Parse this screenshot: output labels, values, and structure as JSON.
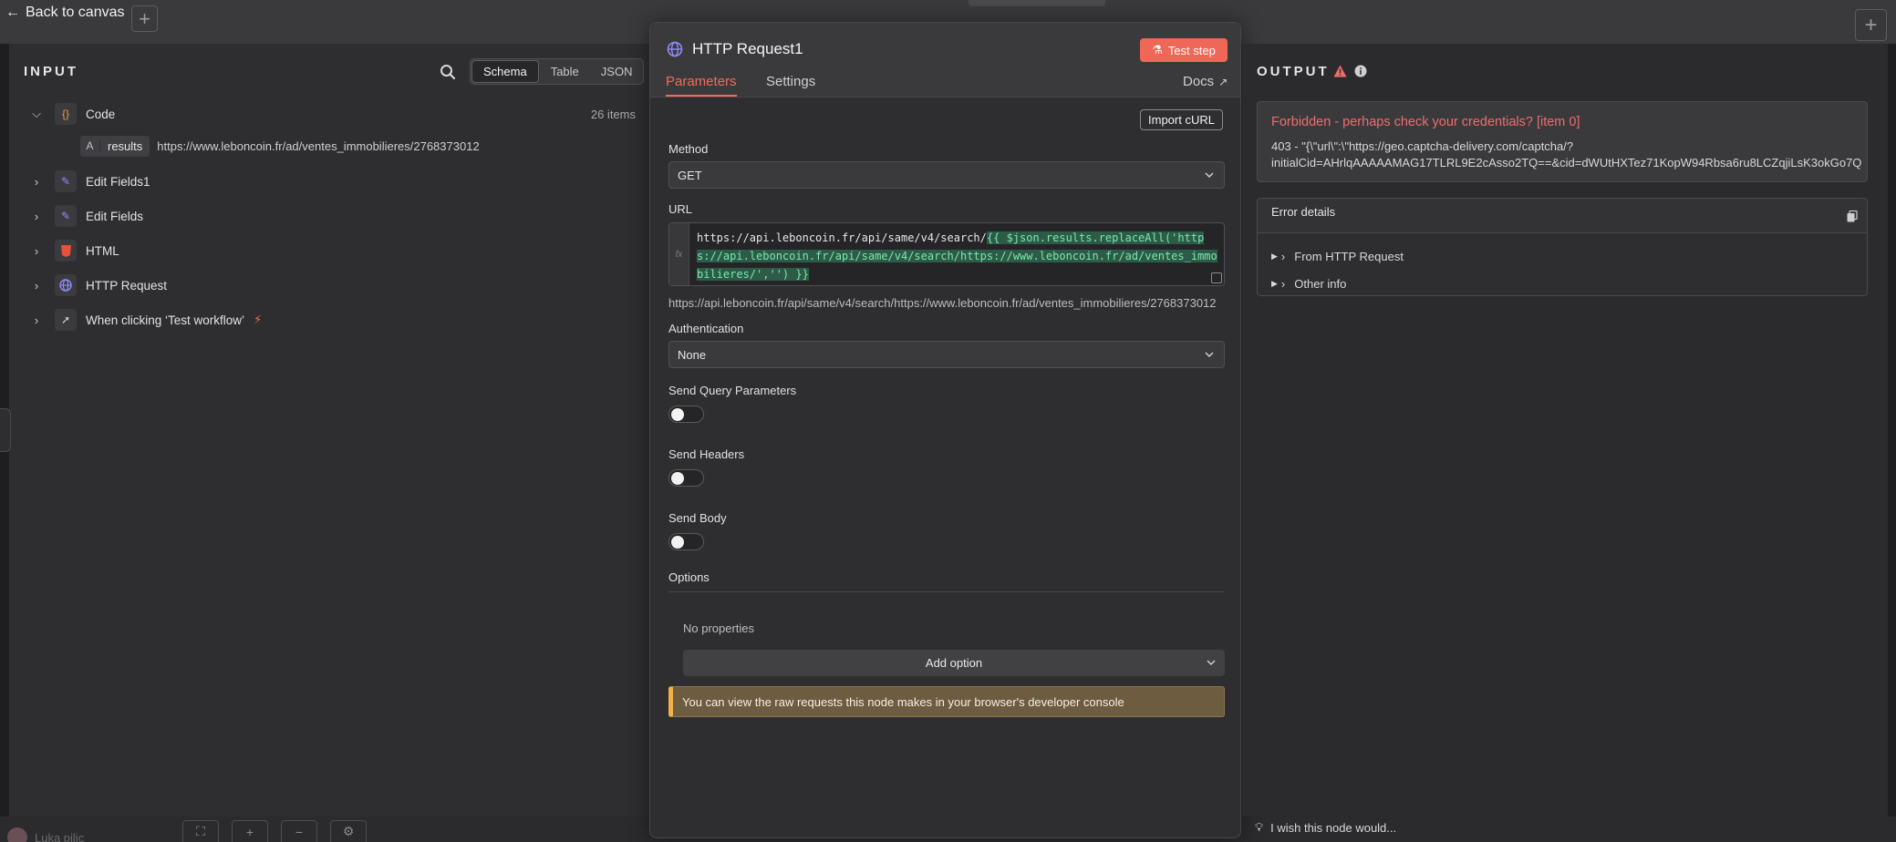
{
  "canvas": {
    "back_label": "Back to canvas",
    "user_name": "Luka pilic"
  },
  "input": {
    "heading": "INPUT",
    "view_modes": [
      "Schema",
      "Table",
      "JSON"
    ],
    "active_view": "Schema",
    "nodes": [
      {
        "name": "Code",
        "icon": "code-braces-icon",
        "count": "26 items",
        "expanded": true
      },
      {
        "name": "Edit Fields1",
        "icon": "pencil-icon"
      },
      {
        "name": "Edit Fields",
        "icon": "pencil-icon"
      },
      {
        "name": "HTML",
        "icon": "html5-icon"
      },
      {
        "name": "HTTP Request",
        "icon": "globe-icon"
      },
      {
        "name": "When clicking ‘Test workflow’",
        "icon": "pointer-icon",
        "badge": "bolt-icon"
      }
    ],
    "schema_field": {
      "type": "A",
      "key": "results",
      "value": "https://www.leboncoin.fr/ad/ventes_immobilieres/2768373012"
    }
  },
  "params": {
    "node_title": "HTTP Request1",
    "test_step_label": "Test step",
    "tabs": [
      "Parameters",
      "Settings"
    ],
    "active_tab": "Parameters",
    "docs_label": "Docs",
    "import_curl_label": "Import cURL",
    "method_label": "Method",
    "method_value": "GET",
    "url_label": "URL",
    "url_fx": "fx",
    "url_prefix": "https://api.leboncoin.fr/api/same/v4/search/",
    "url_expression": "{{ $json.results.replaceAll('https://api.leboncoin.fr/api/same/v4/search/https://www.leboncoin.fr/ad/ventes_immobilieres/','') }}",
    "url_preview": "https://api.leboncoin.fr/api/same/v4/search/https://www.leboncoin.fr/ad/ventes_immobilieres/2768373012",
    "auth_label": "Authentication",
    "auth_value": "None",
    "send_query_label": "Send Query Parameters",
    "send_headers_label": "Send Headers",
    "send_body_label": "Send Body",
    "toggles": {
      "send_query": false,
      "send_headers": false,
      "send_body": false
    },
    "options_label": "Options",
    "no_properties": "No properties",
    "add_option_label": "Add option",
    "notice_text": "You can view the raw requests this node makes in your browser's developer console"
  },
  "output": {
    "heading": "OUTPUT",
    "error_title": "Forbidden - perhaps check your credentials? [item 0]",
    "error_line1": "403 - \"{\\\"url\\\":\\\"https://geo.captcha-delivery.com/captcha/?",
    "error_line2": "initialCid=AHrlqAAAAAMAG17TLRL9E2cAsso2TQ==&cid=dWUtHXTez71KopW94Rbsa6ru8LCZqjiLsK3okGo7Q",
    "details_title": "Error details",
    "detail_rows": [
      "From HTTP Request",
      "Other info"
    ],
    "feedback_label": "I wish this node would..."
  },
  "colors": {
    "accent": "#ef6857",
    "error": "#f16b6b",
    "expression_bg": "#2c5c47",
    "expression_fg": "#7de6b0",
    "notice_border": "#f0b04a"
  }
}
